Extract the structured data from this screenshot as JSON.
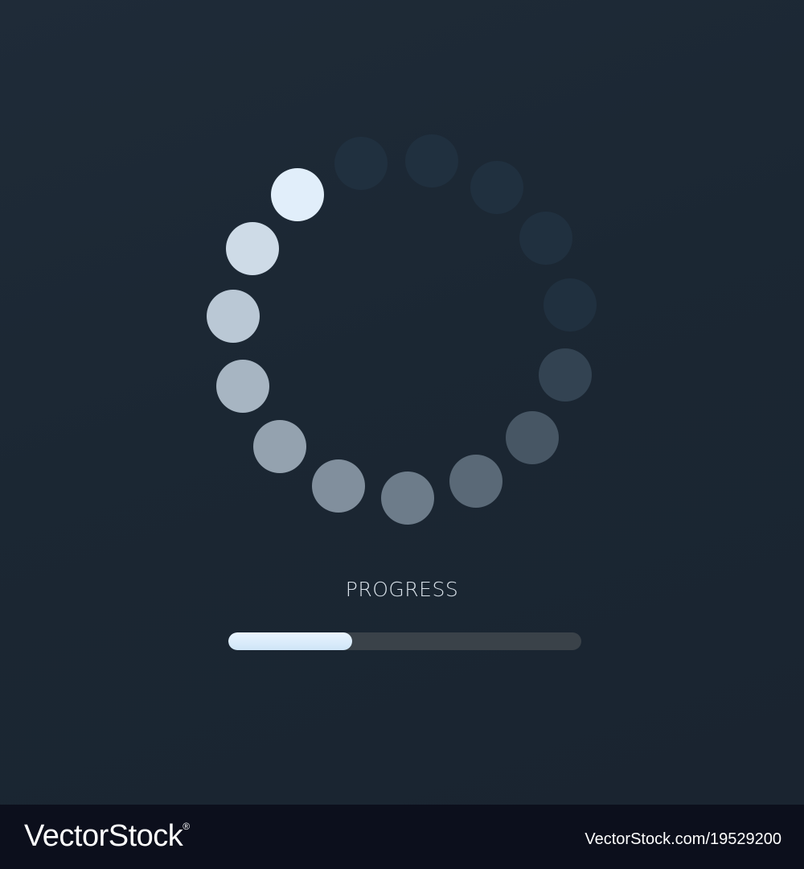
{
  "loader": {
    "label": "PROGRESS",
    "progress_fraction": 0.35,
    "spinner_dot_count": 15,
    "spinner_active_dot": 0,
    "colors": {
      "bright": "#e1eefa",
      "dim": "#20303f",
      "track": "#3a4249",
      "fill": "#d6eafb"
    }
  },
  "footer": {
    "brand": "VectorStock",
    "brand_mark": "®",
    "credit": "VectorStock.com/19529200"
  }
}
